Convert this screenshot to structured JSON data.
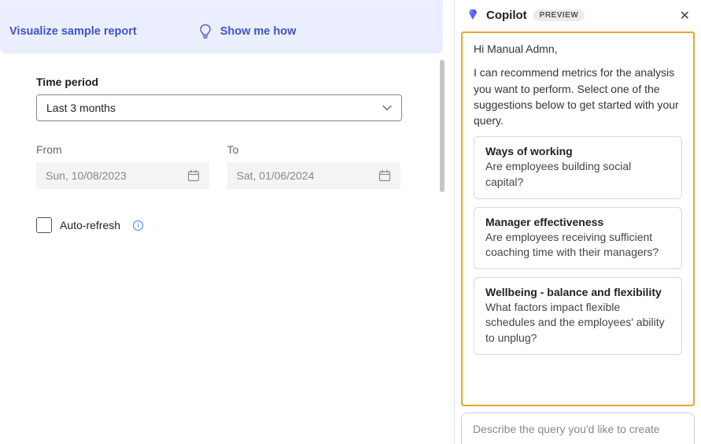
{
  "banner": {
    "visualize_label": "Visualize sample report",
    "show_me_label": "Show me how"
  },
  "form": {
    "time_period_label": "Time period",
    "time_period_value": "Last 3 months",
    "from_label": "From",
    "from_value": "Sun, 10/08/2023",
    "to_label": "To",
    "to_value": "Sat, 01/06/2024",
    "auto_refresh_label": "Auto-refresh"
  },
  "copilot": {
    "title": "Copilot",
    "preview_badge": "PREVIEW",
    "greeting": "Hi Manual Admn,",
    "intro": "I can recommend metrics for the analysis you want to perform. Select one of the suggestions below to get started with your query.",
    "suggestions": [
      {
        "title": "Ways of working",
        "body": "Are employees building social capital?"
      },
      {
        "title": "Manager effectiveness",
        "body": "Are employees receiving sufficient coaching time with their managers?"
      },
      {
        "title": "Wellbeing - balance and flexibility",
        "body": "What factors impact flexible schedules and the employees' ability to unplug?"
      }
    ],
    "input_placeholder": "Describe the query you'd like to create"
  }
}
